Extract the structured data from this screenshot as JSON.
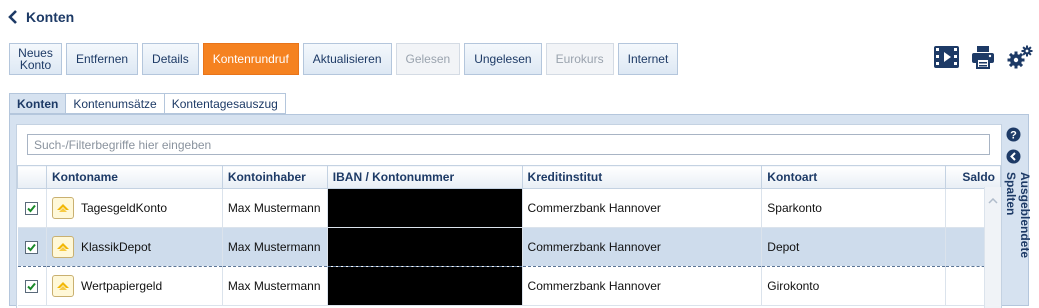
{
  "header": {
    "title": "Konten",
    "back_icon": "chevron-left-icon"
  },
  "toolbar": {
    "buttons": [
      {
        "label": "Neues\nKonto",
        "state": "normal"
      },
      {
        "label": "Entfernen",
        "state": "normal"
      },
      {
        "label": "Details",
        "state": "normal"
      },
      {
        "label": "Kontenrundruf",
        "state": "active"
      },
      {
        "label": "Aktualisieren",
        "state": "normal"
      },
      {
        "label": "Gelesen",
        "state": "disabled"
      },
      {
        "label": "Ungelesen",
        "state": "normal"
      },
      {
        "label": "Eurokurs",
        "state": "disabled"
      },
      {
        "label": "Internet",
        "state": "normal"
      }
    ],
    "right_icons": [
      "video-icon",
      "printer-icon",
      "settings-gears-icon"
    ]
  },
  "tabs": [
    {
      "label": "Konten",
      "active": true
    },
    {
      "label": "Kontenumsätze",
      "active": false
    },
    {
      "label": "Kontentagesauszug",
      "active": false
    }
  ],
  "search": {
    "placeholder": "Such-/Filterbegriffe hier eingeben",
    "value": ""
  },
  "table": {
    "columns": [
      "Kontoname",
      "Kontoinhaber",
      "IBAN / Kontonummer",
      "Kreditinstitut",
      "Kontoart",
      "Saldo"
    ],
    "rows": [
      {
        "checked": true,
        "name": "TagesgeldKonto",
        "holder": "Max Mustermann",
        "iban": "",
        "bank": "Commerzbank Hannover",
        "type": "Sparkonto",
        "saldo": "",
        "selected": false
      },
      {
        "checked": true,
        "name": "KlassikDepot",
        "holder": "Max Mustermann",
        "iban": "",
        "bank": "Commerzbank Hannover",
        "type": "Depot",
        "saldo": "",
        "selected": true
      },
      {
        "checked": true,
        "name": "Wertpapiergeld",
        "holder": "Max Mustermann",
        "iban": "",
        "bank": "Commerzbank Hannover",
        "type": "Girokonto",
        "saldo": "",
        "selected": false
      }
    ]
  },
  "side_panel": {
    "label": "Ausgeblendete Spalten",
    "icons": [
      "help-icon",
      "collapse-left-icon"
    ]
  },
  "colors": {
    "accent": "#f58220",
    "primary": "#1d3a66",
    "panel": "#d6e2f0",
    "selected_row": "#cedcec"
  }
}
